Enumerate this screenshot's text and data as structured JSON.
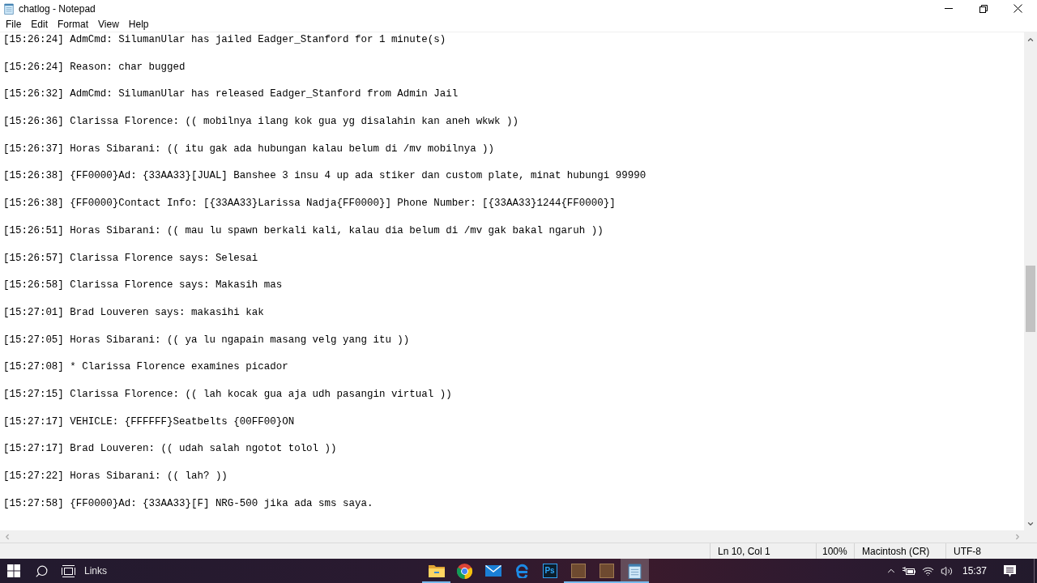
{
  "window": {
    "title": "chatlog - Notepad"
  },
  "menu": [
    "File",
    "Edit",
    "Format",
    "View",
    "Help"
  ],
  "lines": [
    "[15:26:24] AdmCmd: SilumanUlar has jailed Eadger_Stanford for 1 minute(s)",
    "[15:26:24] Reason: char bugged",
    "[15:26:32] AdmCmd: SilumanUlar has released Eadger_Stanford from Admin Jail",
    "[15:26:36] Clarissa Florence: (( mobilnya ilang kok gua yg disalahin kan aneh wkwk ))",
    "[15:26:37] Horas Sibarani: (( itu gak ada hubungan kalau belum di /mv mobilnya ))",
    "[15:26:38] {FF0000}Ad: {33AA33}[JUAL] Banshee 3 insu 4 up ada stiker dan custom plate, minat hubungi 99990",
    "[15:26:38] {FF0000}Contact Info: [{33AA33}Larissa Nadja{FF0000}] Phone Number: [{33AA33}1244{FF0000}]",
    "[15:26:51] Horas Sibarani: (( mau lu spawn berkali kali, kalau dia belum di /mv gak bakal ngaruh ))",
    "[15:26:57] Clarissa Florence says: Selesai",
    "[15:26:58] Clarissa Florence says: Makasih mas",
    "[15:27:01] Brad Louveren says: makasihi kak",
    "[15:27:05] Horas Sibarani: (( ya lu ngapain masang velg yang itu ))",
    "[15:27:08] * Clarissa Florence examines picador",
    "[15:27:15] Clarissa Florence: (( lah kocak gua aja udh pasangin virtual ))",
    "[15:27:17] VEHICLE: {FFFFFF}Seatbelts {00FF00}ON",
    "[15:27:17] Brad Louveren: (( udah salah ngotot tolol ))",
    "[15:27:22] Horas Sibarani: (( lah? ))",
    "[15:27:58] {FF0000}Ad: {33AA33}[F] NRG-500 jika ada sms saya."
  ],
  "status_bar": {
    "position": "Ln 10, Col 1",
    "zoom": "100%",
    "line_ending": "Macintosh (CR)",
    "encoding": "UTF-8"
  },
  "taskbar": {
    "toolbar_label": "Links",
    "apps": [
      {
        "kind": "folder",
        "running": true,
        "selected": false
      },
      {
        "kind": "chrome",
        "running": false,
        "selected": false
      },
      {
        "kind": "mail",
        "running": false,
        "selected": false
      },
      {
        "kind": "edge",
        "running": false,
        "selected": false
      },
      {
        "kind": "ps",
        "label": "Ps",
        "running": false,
        "selected": false
      },
      {
        "kind": "picture",
        "running": true,
        "selected": false
      },
      {
        "kind": "picture",
        "running": true,
        "selected": false
      },
      {
        "kind": "notepad",
        "running": true,
        "selected": true
      }
    ],
    "clock": "15:37"
  }
}
